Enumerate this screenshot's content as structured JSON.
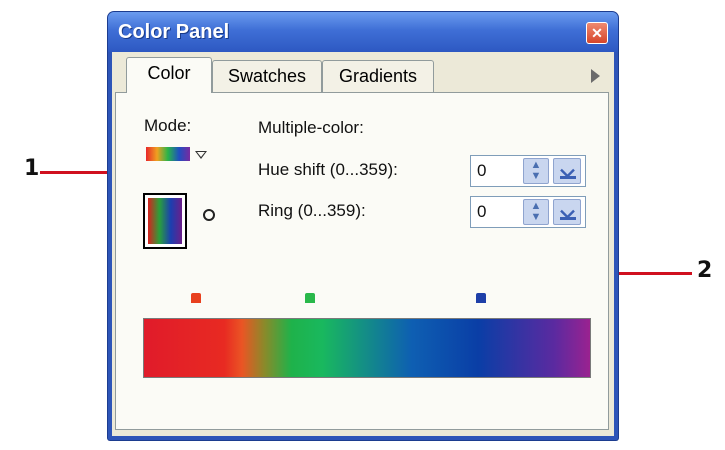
{
  "window": {
    "title": "Color Panel"
  },
  "tabs": [
    {
      "label": "Color",
      "active": true
    },
    {
      "label": "Swatches",
      "active": false
    },
    {
      "label": "Gradients",
      "active": false
    }
  ],
  "panel": {
    "mode_label": "Mode:",
    "multiple_label": "Multiple-color:",
    "hue_shift": {
      "label": "Hue shift (0...359):",
      "value": "0"
    },
    "ring": {
      "label": "Ring (0...359):",
      "value": "0"
    }
  },
  "gradient_markers": [
    {
      "color": "#e8401e"
    },
    {
      "color": "#29b84a"
    },
    {
      "color": "#1e3fa8"
    }
  ],
  "callouts": [
    {
      "number": "1",
      "points_to": "hue_shift"
    },
    {
      "number": "2",
      "points_to": "ring"
    }
  ],
  "colors": {
    "callout_line": "#d0101f",
    "titlebar": "#3f6fd6"
  },
  "icons": {
    "close": "close-icon",
    "tab_scroll": "chevron-right-icon",
    "mode_dropdown": "chevron-down-icon",
    "cycle": "cycle-icon",
    "spin": "spinner-icon",
    "field_dropdown": "chevron-down-icon"
  }
}
